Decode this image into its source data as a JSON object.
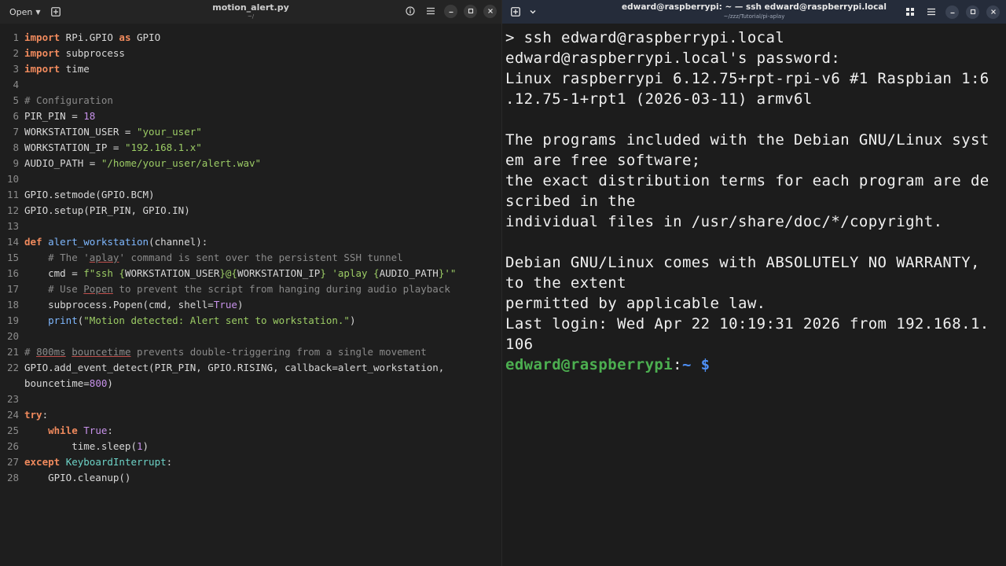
{
  "editor": {
    "open_label": "Open",
    "title": "motion_alert.py",
    "subtitle": "~/",
    "lines": [
      {
        "n": "1"
      },
      {
        "n": "2"
      },
      {
        "n": "3"
      },
      {
        "n": "4"
      },
      {
        "n": "5"
      },
      {
        "n": "6"
      },
      {
        "n": "7"
      },
      {
        "n": "8"
      },
      {
        "n": "9"
      },
      {
        "n": "10"
      },
      {
        "n": "11"
      },
      {
        "n": "12"
      },
      {
        "n": "13"
      },
      {
        "n": "14"
      },
      {
        "n": "15"
      },
      {
        "n": "16"
      },
      {
        "n": "17"
      },
      {
        "n": "18"
      },
      {
        "n": "19"
      },
      {
        "n": "20"
      },
      {
        "n": "21"
      },
      {
        "n": "22"
      },
      {
        "n": "23"
      },
      {
        "n": "24"
      },
      {
        "n": "25"
      },
      {
        "n": "26"
      },
      {
        "n": "27"
      },
      {
        "n": "28"
      }
    ],
    "code": {
      "l1a": "import",
      "l1b": " RPi.GPIO ",
      "l1c": "as",
      "l1d": " GPIO",
      "l2a": "import",
      "l2b": " subprocess",
      "l3a": "import",
      "l3b": " time",
      "l5": "# Configuration",
      "l6a": "PIR_PIN = ",
      "l6b": "18",
      "l7a": "WORKSTATION_USER = ",
      "l7b": "\"your_user\"",
      "l8a": "WORKSTATION_IP = ",
      "l8b": "\"192.168.1.x\"",
      "l9a": "AUDIO_PATH = ",
      "l9b": "\"/home/your_user/alert.wav\"",
      "l11": "GPIO.setmode(GPIO.BCM)",
      "l12": "GPIO.setup(PIR_PIN, GPIO.IN)",
      "l14a": "def",
      "l14b": " ",
      "l14c": "alert_workstation",
      "l14d": "(channel):",
      "l15a": "    # The '",
      "l15b": "aplay",
      "l15c": "' command is sent over the persistent SSH tunnel",
      "l16a": "    cmd = ",
      "l16b": "f\"ssh {",
      "l16c": "WORKSTATION_USER",
      "l16d": "}@{",
      "l16e": "WORKSTATION_IP",
      "l16f": "} 'aplay {",
      "l16g": "AUDIO_PATH",
      "l16h": "}'\"",
      "l17a": "    # Use ",
      "l17b": "Popen",
      "l17c": " to prevent the script from hanging during audio playback",
      "l18a": "    subprocess.Popen(cmd, shell=",
      "l18b": "True",
      "l18c": ")",
      "l19a": "    ",
      "l19b": "print",
      "l19c": "(",
      "l19d": "\"Motion detected: Alert sent to workstation.\"",
      "l19e": ")",
      "l21a": "# ",
      "l21b": "800ms",
      "l21c": " ",
      "l21d": "bouncetime",
      "l21e": " prevents double-triggering from a single movement",
      "l22": "GPIO.add_event_detect(PIR_PIN, GPIO.RISING, callback=alert_workstation,",
      "l22b_a": "bouncetime=",
      "l22b_b": "800",
      "l22b_c": ")",
      "l24a": "try",
      "l24b": ":",
      "l25a": "    ",
      "l25b": "while",
      "l25c": " ",
      "l25d": "True",
      "l25e": ":",
      "l26a": "        time.sleep(",
      "l26b": "1",
      "l26c": ")",
      "l27a": "except",
      "l27b": " ",
      "l27c": "KeyboardInterrupt",
      "l27d": ":",
      "l28": "    GPIO.cleanup()"
    }
  },
  "terminal": {
    "title": "edward@raspberrypi: ~ — ssh edward@raspberrypi.local",
    "subtitle": "~/zzz/Tutorial/pi-aplay",
    "lines": [
      "> ssh edward@raspberrypi.local",
      "edward@raspberrypi.local's password:",
      "Linux raspberrypi 6.12.75+rpt-rpi-v6 #1 Raspbian 1:6",
      ".12.75-1+rpt1 (2026-03-11) armv6l",
      "",
      "The programs included with the Debian GNU/Linux syst",
      "em are free software;",
      "the exact distribution terms for each program are de",
      "scribed in the",
      "individual files in /usr/share/doc/*/copyright.",
      "",
      "Debian GNU/Linux comes with ABSOLUTELY NO WARRANTY,",
      "to the extent",
      "permitted by applicable law.",
      "Last login: Wed Apr 22 10:19:31 2026 from 192.168.1.",
      "106"
    ],
    "prompt": {
      "user": "edward@raspberrypi",
      "colon": ":",
      "path": "~",
      "dollar": " $"
    }
  },
  "colors": {
    "keyword": "#f08a5d",
    "string": "#9ccc65",
    "number": "#c792ea",
    "comment": "#8a8a8a",
    "function": "#7fb8ff",
    "prompt_user": "#4caf50",
    "prompt_path": "#4e8ff5"
  },
  "icons": {
    "editor": [
      "chevron-down-icon",
      "new-tab-icon",
      "info-icon",
      "menu-icon",
      "minimize-icon",
      "maximize-icon",
      "close-icon"
    ],
    "terminal": [
      "new-tab-icon",
      "chevron-down-icon",
      "grid-icon",
      "menu-icon",
      "minimize-icon",
      "maximize-icon",
      "close-icon"
    ]
  }
}
